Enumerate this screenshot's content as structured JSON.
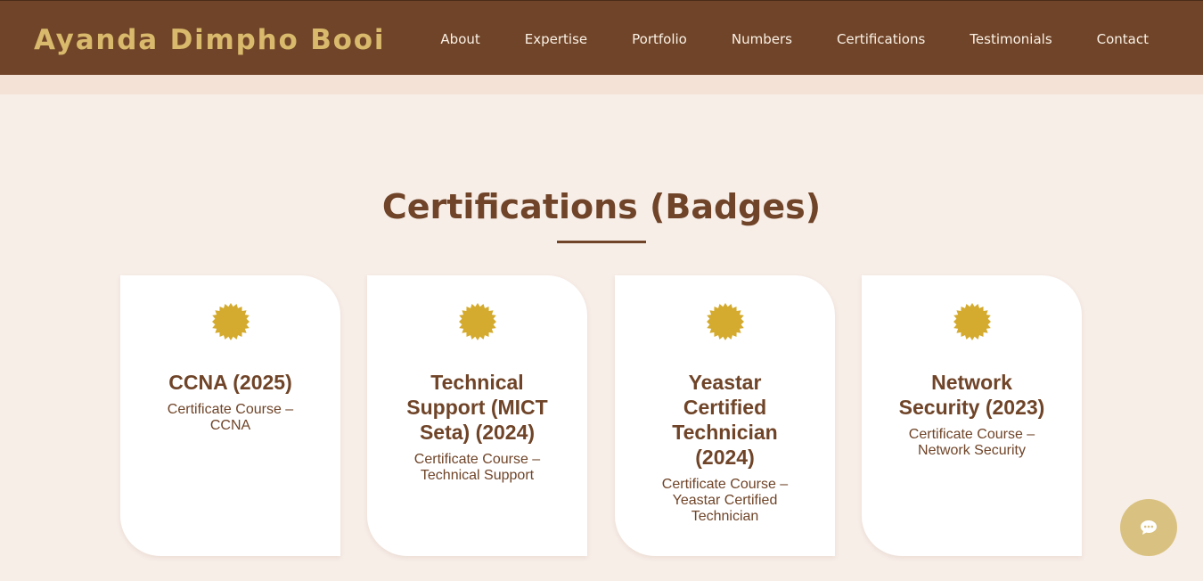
{
  "brand": "Ayanda Dimpho Booi",
  "nav": [
    "About",
    "Expertise",
    "Portfolio",
    "Numbers",
    "Certifications",
    "Testimonials",
    "Contact"
  ],
  "section": {
    "title": "Certifications (Badges)"
  },
  "cards": [
    {
      "title": "CCNA (2025)",
      "desc": "Certificate Course – CCNA"
    },
    {
      "title": "Technical Support (MICT Seta) (2024)",
      "desc": "Certificate Course – Technical Support"
    },
    {
      "title": "Yeastar Certified Technician (2024)",
      "desc": "Certificate Course – Yeastar Certified Technician"
    },
    {
      "title": "Network Security (2023)",
      "desc": "Certificate Course – Network Security"
    }
  ],
  "icons": {
    "badge": "badge-icon",
    "chat": "chat-icon"
  },
  "colors": {
    "header_bg": "#6f4428",
    "brand_gold": "#d9b96c",
    "accent_brown": "#6f4428",
    "badge_gold": "#d4ab2f",
    "page_bg": "#f8eee8",
    "chat_button": "#d9c281"
  }
}
